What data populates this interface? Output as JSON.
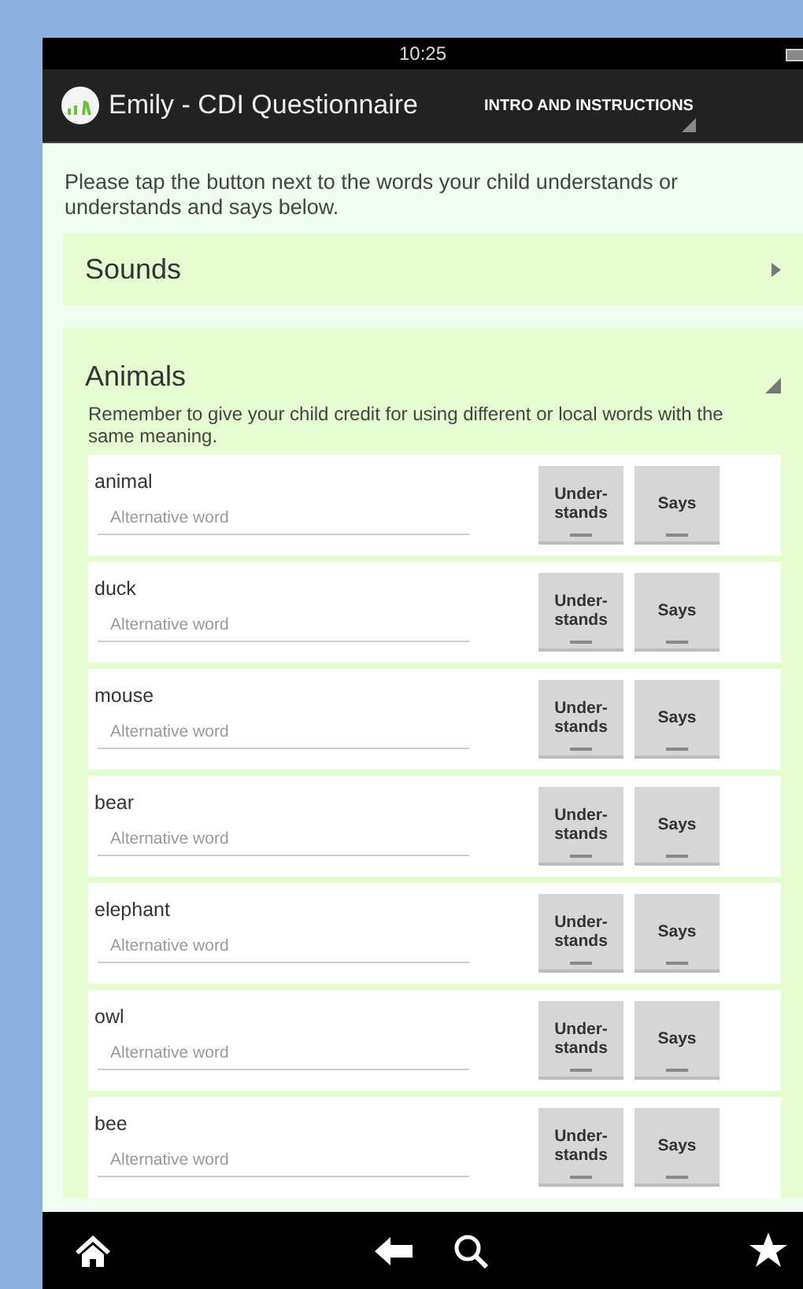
{
  "status_bar": {
    "time": "10:25"
  },
  "action_bar": {
    "title": "Emily - CDI Questionnaire",
    "section_dropdown": "INTRO AND INSTRUCTIONS"
  },
  "instructions": "Please tap the button next to the words your child understands or understands and says below.",
  "sections": [
    {
      "title": "Sounds",
      "expanded": false
    },
    {
      "title": "Animals",
      "expanded": true,
      "note": "Remember to give your child credit for using different or local words with the same meaning.",
      "words": [
        {
          "word": "animal",
          "placeholder": "Alternative word",
          "understands": {
            "label": "Under-\nstands",
            "checked": false
          },
          "says": {
            "label": "Says",
            "checked": false
          }
        },
        {
          "word": "duck",
          "placeholder": "Alternative word",
          "understands": {
            "label": "Under-\nstands",
            "checked": false
          },
          "says": {
            "label": "Says",
            "checked": false
          }
        },
        {
          "word": "mouse",
          "placeholder": "Alternative word",
          "understands": {
            "label": "Under-\nstands",
            "checked": false
          },
          "says": {
            "label": "Says",
            "checked": false
          }
        },
        {
          "word": "bear",
          "placeholder": "Alternative word",
          "understands": {
            "label": "Under-\nstands",
            "checked": false
          },
          "says": {
            "label": "Says",
            "checked": false
          }
        },
        {
          "word": "elephant",
          "placeholder": "Alternative word",
          "understands": {
            "label": "Under-\nstands",
            "checked": false
          },
          "says": {
            "label": "Says",
            "checked": false
          }
        },
        {
          "word": "owl",
          "placeholder": "Alternative word",
          "understands": {
            "label": "Under-\nstands",
            "checked": false
          },
          "says": {
            "label": "Says",
            "checked": false
          }
        },
        {
          "word": "bee",
          "placeholder": "Alternative word",
          "understands": {
            "label": "Under-\nstands",
            "checked": false
          },
          "says": {
            "label": "Says",
            "checked": false
          }
        }
      ]
    }
  ]
}
